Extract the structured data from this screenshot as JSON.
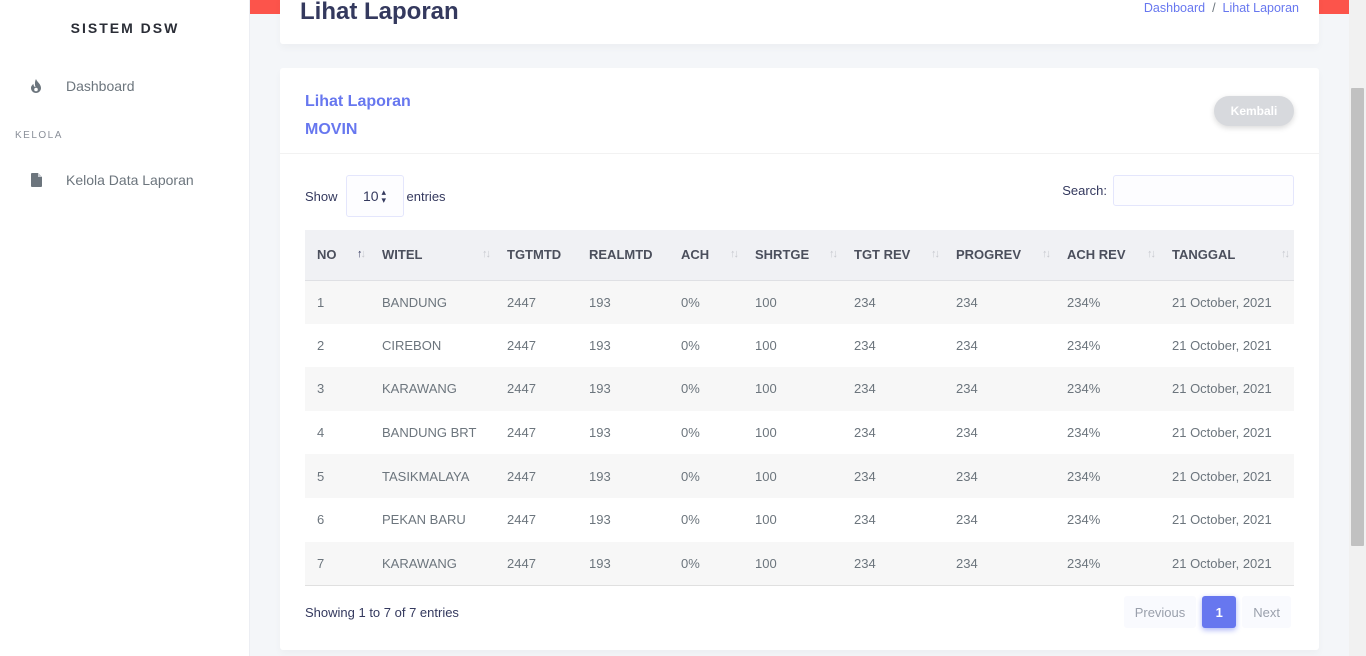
{
  "sidebar": {
    "brand": "SISTEM DSW",
    "dashboard_label": "Dashboard",
    "section_header": "KELOLA",
    "kelola_label": "Kelola Data Laporan"
  },
  "header": {
    "title": "Lihat Laporan",
    "breadcrumb": [
      "Dashboard",
      "/",
      "Lihat Laporan"
    ]
  },
  "card": {
    "title_line1": "Lihat Laporan",
    "title_line2": "MOVIN",
    "back_button": "Kembali"
  },
  "controls": {
    "show_label": "Show",
    "entries_value": "10",
    "entries_label": "entries",
    "search_label": "Search:"
  },
  "table": {
    "columns": [
      "NO",
      "WITEL",
      "TGTMTD",
      "REALMTD",
      "ACH",
      "SHRTGE",
      "TGT REV",
      "PROGREV",
      "ACH REV",
      "TANGGAL"
    ],
    "rows": [
      [
        "1",
        "BANDUNG",
        "2447",
        "193",
        "0%",
        "100",
        "234",
        "234",
        "234%",
        "21 October, 2021"
      ],
      [
        "2",
        "CIREBON",
        "2447",
        "193",
        "0%",
        "100",
        "234",
        "234",
        "234%",
        "21 October, 2021"
      ],
      [
        "3",
        "KARAWANG",
        "2447",
        "193",
        "0%",
        "100",
        "234",
        "234",
        "234%",
        "21 October, 2021"
      ],
      [
        "4",
        "BANDUNG BRT",
        "2447",
        "193",
        "0%",
        "100",
        "234",
        "234",
        "234%",
        "21 October, 2021"
      ],
      [
        "5",
        "TASIKMALAYA",
        "2447",
        "193",
        "0%",
        "100",
        "234",
        "234",
        "234%",
        "21 October, 2021"
      ],
      [
        "6",
        "PEKAN BARU",
        "2447",
        "193",
        "0%",
        "100",
        "234",
        "234",
        "234%",
        "21 October, 2021"
      ],
      [
        "7",
        "KARAWANG",
        "2447",
        "193",
        "0%",
        "100",
        "234",
        "234",
        "234%",
        "21 October, 2021"
      ]
    ]
  },
  "footer": {
    "info": "Showing 1 to 7 of 7 entries",
    "previous": "Previous",
    "page": "1",
    "next": "Next"
  },
  "colors": {
    "accent": "#6777ef",
    "danger": "#fc544b"
  },
  "icons": {
    "dashboard": "fire-icon",
    "kelola": "file-icon"
  }
}
